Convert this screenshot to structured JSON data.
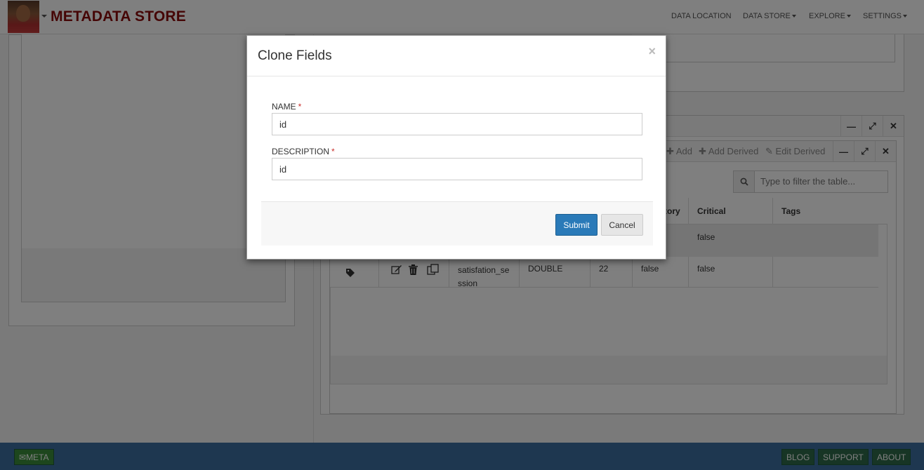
{
  "navbar": {
    "brand": "METADATA STORE",
    "items": [
      {
        "label": "DATA LOCATION",
        "has_caret": false
      },
      {
        "label": "DATA STORE",
        "has_caret": true
      },
      {
        "label": "EXPLORE",
        "has_caret": true
      },
      {
        "label": "SETTINGS",
        "has_caret": true
      }
    ]
  },
  "background": {
    "toolbar": {
      "add": "Add",
      "add_derived": "Add Derived",
      "edit_derived": "Edit Derived"
    },
    "filter_placeholder": "Type to filter the table...",
    "table": {
      "headers": [
        "tory",
        "Critical",
        "Tags"
      ],
      "rows": [
        {
          "critical": "false"
        },
        {
          "name_line1": "satisfation_se",
          "name_line2": "ssion",
          "type": "DOUBLE",
          "length": "22",
          "mandatory": "false",
          "critical": "false"
        }
      ]
    }
  },
  "modal": {
    "title": "Clone Fields",
    "close": "×",
    "name_label": "NAME",
    "name_value": "id",
    "description_label": "DESCRIPTION",
    "description_value": "id",
    "required_mark": "*",
    "submit": "Submit",
    "cancel": "Cancel"
  },
  "footer": {
    "meta": "META",
    "blog": "BLOG",
    "support": "SUPPORT",
    "about": "ABOUT"
  },
  "colors": {
    "brand": "#8b0a0a",
    "primary": "#2a7ab8",
    "footer": "#3c6fa0",
    "required": "#c9302c"
  }
}
